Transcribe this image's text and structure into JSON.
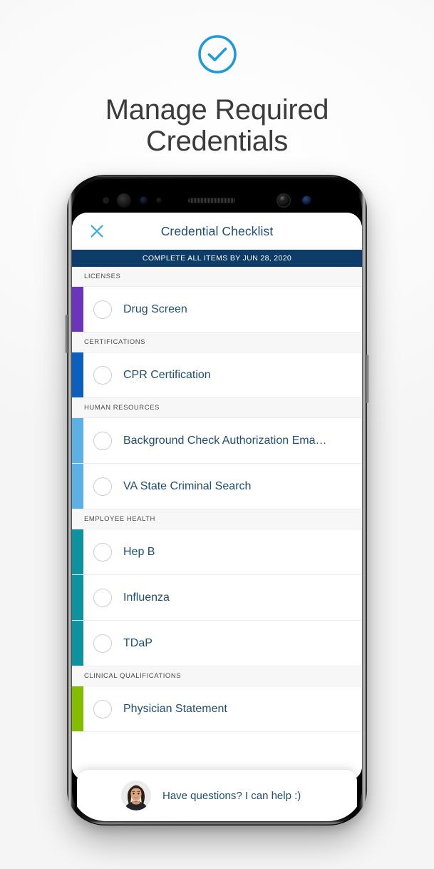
{
  "hero": {
    "logo_icon": "check-circle-icon",
    "logo_color": "#1e9ad6",
    "title_line1": "Manage Required",
    "title_line2": "Credentials"
  },
  "phone": {
    "bezel_icons": [
      "ir-sensor-icon",
      "face-sensor-icon",
      "proximity-sensor-icon",
      "ambient-light-sensor-icon",
      "earpiece-speaker-icon",
      "front-camera-icon",
      "iris-scanner-icon"
    ],
    "power_button": "power-button",
    "volume_button": "volume-button"
  },
  "app": {
    "close_icon": "close-icon",
    "close_color": "#2fa8e0",
    "title": "Credential Checklist",
    "title_color": "#1f4e73",
    "banner": {
      "text": "COMPLETE ALL ITEMS BY JUN 28, 2020",
      "background": "#0c3c67",
      "text_color": "#ffffff"
    },
    "sections": [
      {
        "label": "LICENSES",
        "accent": "#6a34bd",
        "items": [
          {
            "label": "Drug Screen",
            "checked": false
          }
        ]
      },
      {
        "label": "CERTIFICATIONS",
        "accent": "#0a5fbf",
        "items": [
          {
            "label": "CPR Certification",
            "checked": false
          }
        ]
      },
      {
        "label": "HUMAN RESOURCES",
        "accent": "#5bb0e5",
        "items": [
          {
            "label": "Background Check Authorization Ema…",
            "checked": false
          },
          {
            "label": "VA State Criminal Search",
            "checked": false
          }
        ]
      },
      {
        "label": "EMPLOYEE HEALTH",
        "accent": "#0d93a0",
        "items": [
          {
            "label": "Hep B",
            "checked": false
          },
          {
            "label": "Influenza",
            "checked": false
          },
          {
            "label": "TDaP",
            "checked": false
          }
        ]
      },
      {
        "label": "CLINICAL QUALIFICATIONS",
        "accent": "#84bd00",
        "items": [
          {
            "label": "Physician Statement",
            "checked": false
          }
        ]
      }
    ],
    "chat": {
      "avatar_icon": "agent-avatar",
      "message": "Have questions? I can help :)"
    }
  }
}
